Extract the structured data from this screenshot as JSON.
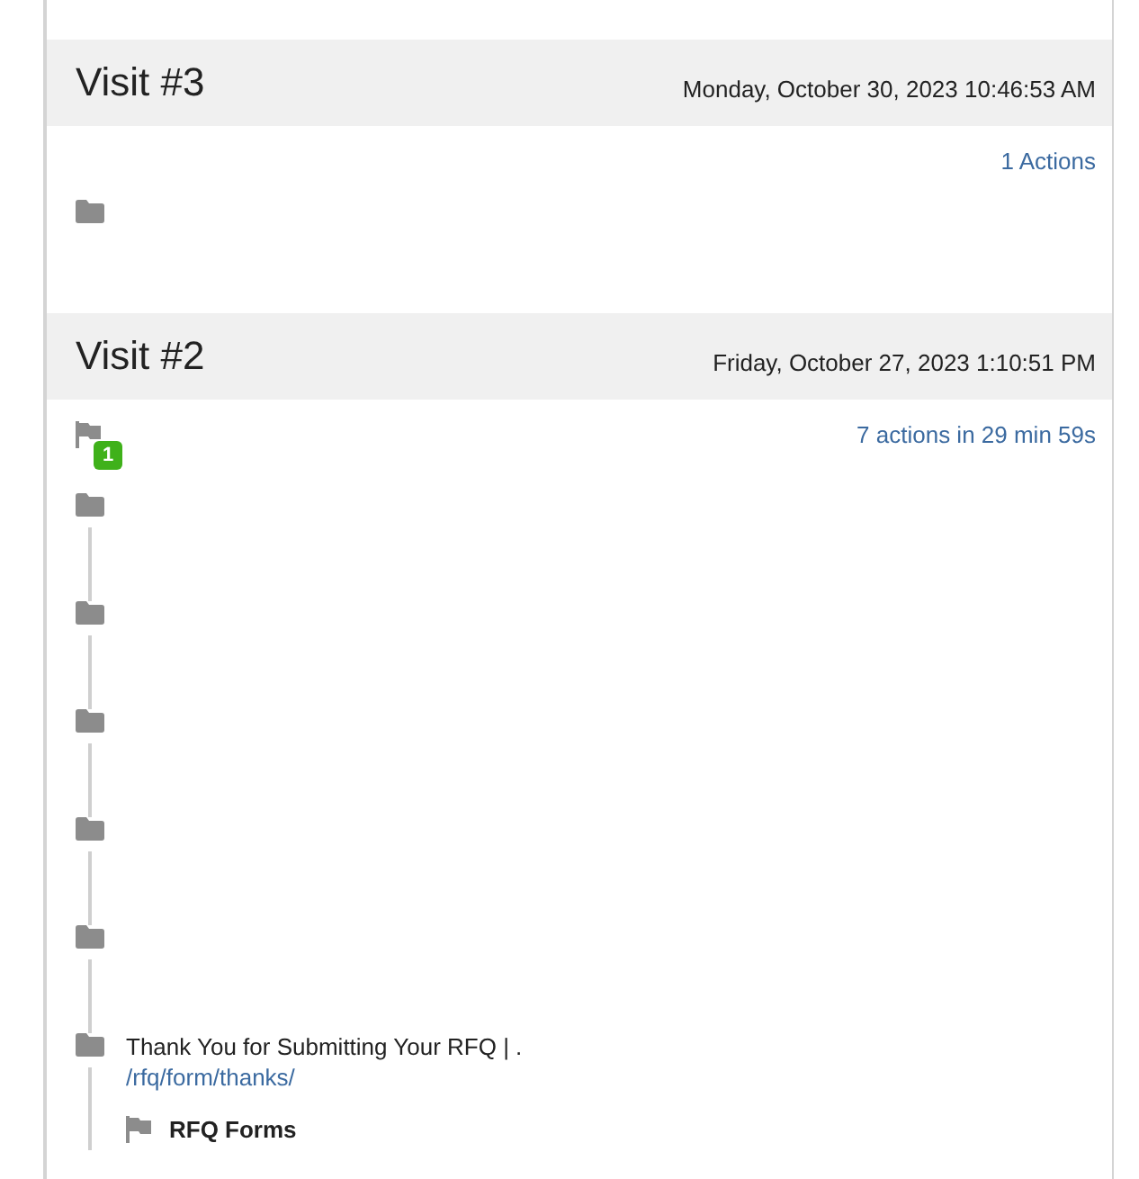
{
  "visits": [
    {
      "title": "Visit #3",
      "date": "Monday, October 30, 2023 10:46:53 AM",
      "summary": "1 Actions",
      "actions": [
        {
          "kind": "page"
        }
      ]
    },
    {
      "title": "Visit #2",
      "date": "Friday, October 27, 2023 1:10:51 PM",
      "summary": "7 actions in 29 min 59s",
      "actions": [
        {
          "kind": "goal",
          "badge": "1"
        },
        {
          "kind": "page"
        },
        {
          "kind": "page"
        },
        {
          "kind": "page"
        },
        {
          "kind": "page"
        },
        {
          "kind": "page"
        },
        {
          "kind": "page",
          "title": "Thank You for Submitting Your RFQ | .",
          "url": "/rfq/form/thanks/",
          "children": [
            {
              "kind": "event",
              "label": "RFQ Forms"
            }
          ]
        }
      ]
    }
  ]
}
